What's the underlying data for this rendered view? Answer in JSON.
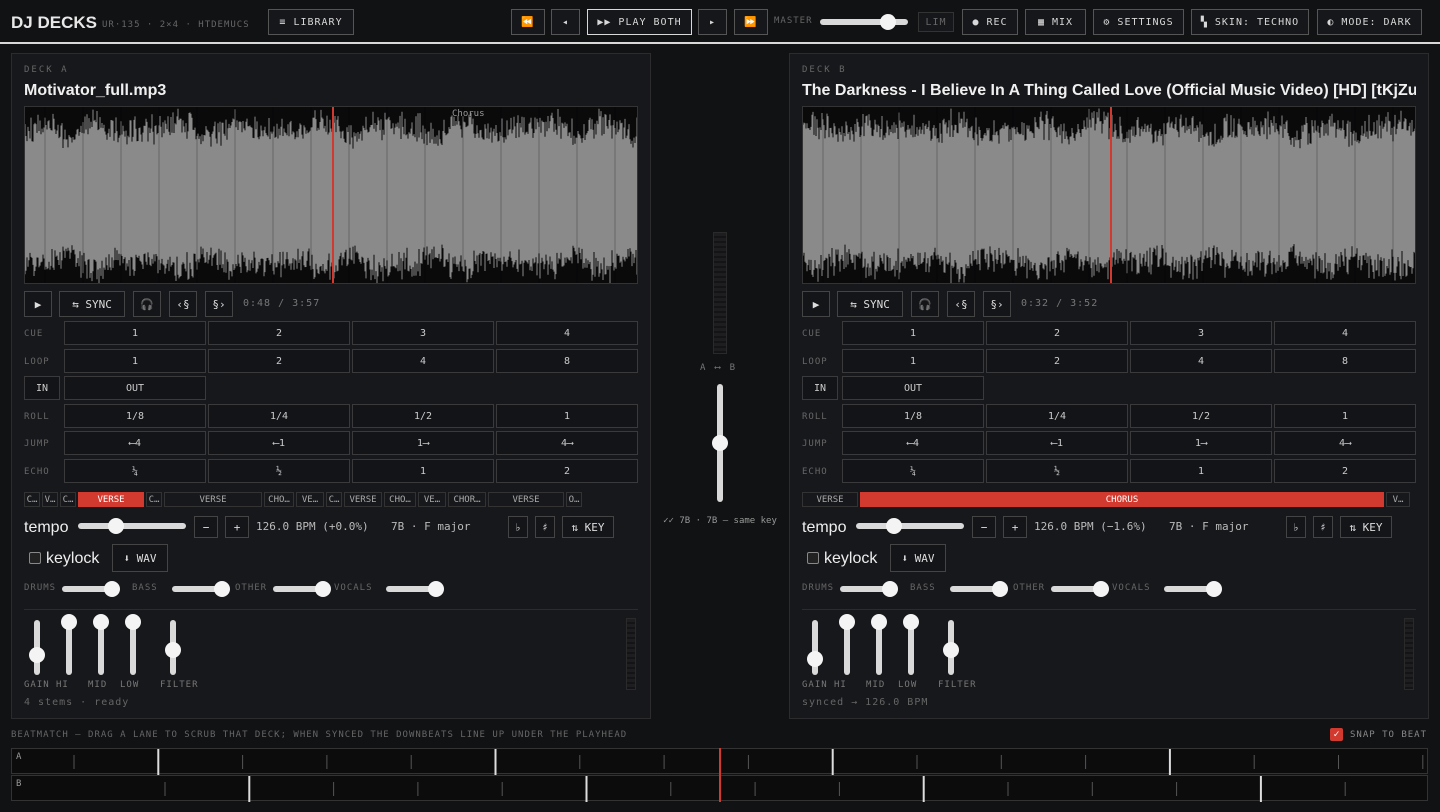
{
  "app": {
    "title": "DJ DECKS",
    "subtitle": "UR·135 · 2×4 · HTDEMUCS"
  },
  "toolbar": {
    "library": "≡ LIBRARY",
    "rewind": "⏪",
    "prev": "◂",
    "play_both": "▶▶ PLAY BOTH",
    "next": "▸",
    "forward": "⏩",
    "master_label": "MASTER",
    "master_level": 0.8,
    "lim": "LIM",
    "rec": "● REC",
    "mix": "▦ MIX",
    "settings": "⚙ SETTINGS",
    "skin": "▚ SKIN: TECHNO",
    "mode": "◐ MODE: DARK"
  },
  "labels": {
    "cue": "CUE",
    "loop": "LOOP",
    "roll": "ROLL",
    "jump": "JUMP",
    "echo": "ECHO",
    "in": "IN",
    "out": "OUT",
    "tempo": "tempo",
    "keylock": "keylock",
    "wav": "⬇ WAV",
    "sync": "⇆ SYNC",
    "play": "▶",
    "headphones": "🎧",
    "loop_back": "‹§",
    "loop_fwd": "§›",
    "minus": "−",
    "plus": "+",
    "flat": "♭",
    "sharp": "♯",
    "key": "⇅ KEY",
    "drums": "DRUMS",
    "bass": "BASS",
    "other": "OTHER",
    "vocals": "VOCALS",
    "gain": "GAIN",
    "hi": "HI",
    "mid": "MID",
    "low": "LOW",
    "filter": "FILTER"
  },
  "pads": {
    "cue": [
      "1",
      "2",
      "3",
      "4"
    ],
    "loop": [
      "1",
      "2",
      "4",
      "8"
    ],
    "roll": [
      "1/8",
      "1/4",
      "1/2",
      "1"
    ],
    "jump": [
      "⟵4",
      "⟵1",
      "1⟶",
      "4⟶"
    ],
    "echo": [
      "¼",
      "½",
      "1",
      "2"
    ]
  },
  "decks": [
    {
      "label": "DECK A",
      "track": "Motivator_full.mp3",
      "time": "0:48 / 3:57",
      "playhead": 0.5,
      "wave_label": "Chorus",
      "bpm": "126.0 BPM (+0.0%)",
      "key": "7B · F major",
      "tempo": 0.35,
      "footer": "4 stems · ready",
      "segments": [
        {
          "t": "C…",
          "w": 18
        },
        {
          "t": "V…",
          "w": 18
        },
        {
          "t": "C…",
          "w": 18
        },
        {
          "t": "VERSE",
          "w": 68,
          "on": true
        },
        {
          "t": "C…",
          "w": 18
        },
        {
          "t": "VERSE",
          "w": 100
        },
        {
          "t": "CHO…",
          "w": 32
        },
        {
          "t": "VE…",
          "w": 30
        },
        {
          "t": "C…",
          "w": 18
        },
        {
          "t": "VERSE",
          "w": 40
        },
        {
          "t": "CHO…",
          "w": 34
        },
        {
          "t": "VE…",
          "w": 30
        },
        {
          "t": "CHOR…",
          "w": 40
        },
        {
          "t": "VERSE",
          "w": 78
        },
        {
          "t": "O…",
          "w": 18
        }
      ],
      "stems": [
        0.9,
        0.9,
        0.9,
        0.9
      ],
      "eq": [
        0.6,
        0.0,
        0.0,
        0.0,
        0.5
      ]
    },
    {
      "label": "DECK B",
      "track": "The Darkness - I Believe In A Thing Called Love (Official Music Video) [HD] [tKjZuyk",
      "time": "0:32 / 3:52",
      "playhead": 0.5,
      "wave_label": "",
      "bpm": "126.0 BPM (−1.6%)",
      "key": "7B · F major",
      "tempo": 0.35,
      "footer": "synced → 126.0 BPM",
      "segments": [
        {
          "t": "VERSE",
          "w": 58
        },
        {
          "t": "CHORUS",
          "w": 526,
          "on": true
        },
        {
          "t": "V…",
          "w": 26
        }
      ],
      "stems": [
        0.9,
        0.9,
        0.9,
        0.9
      ],
      "eq": [
        0.68,
        0.0,
        0.0,
        0.0,
        0.5
      ]
    }
  ],
  "center": {
    "ab": "A ⟷ B",
    "crossfader": 0.5,
    "key_match": "✓✓ 7B · 7B — same key"
  },
  "beatmatch": {
    "caption": "BEATMATCH — DRAG A LANE TO SCRUB THAT DECK; WHEN SYNCED THE DOWNBEATS LINE UP UNDER THE PLAYHEAD",
    "snap": "SNAP TO BEAT",
    "lanes": [
      "A",
      "B"
    ]
  },
  "colors": {
    "accent": "#d33a2f"
  }
}
